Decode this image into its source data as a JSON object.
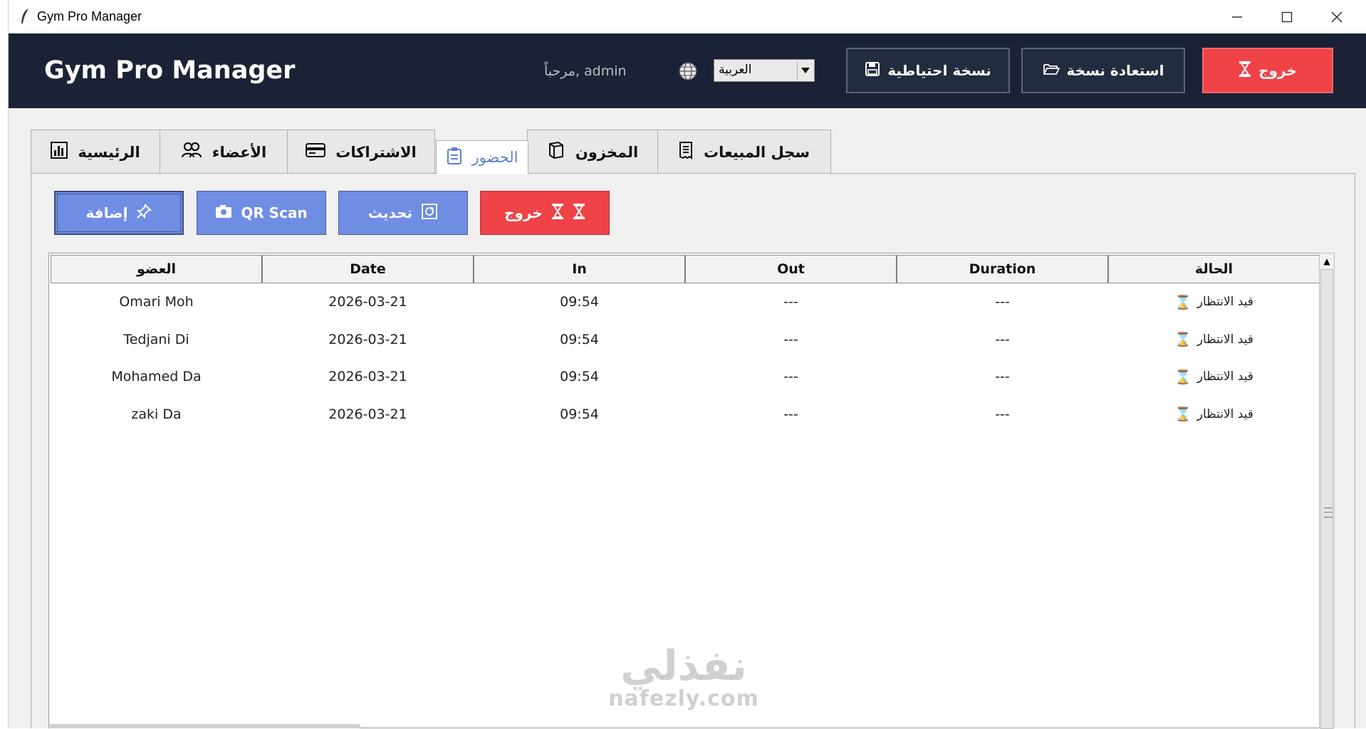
{
  "window": {
    "title": "Gym Pro Manager",
    "controls": {
      "minimize": "—",
      "maximize": "☐",
      "close": "✕"
    }
  },
  "header": {
    "brand": "Gym Pro Manager",
    "welcome": "مرحباً, admin",
    "language": "العربية",
    "backup_label": "نسخة احتياطية",
    "restore_label": "استعادة نسخة",
    "logout_label": "خروج",
    "colors": {
      "background": "#1b2235",
      "logout": "#ef4348"
    }
  },
  "tabs": [
    {
      "label": "سجل المبيعات",
      "icon": "receipt-icon"
    },
    {
      "label": "المخزون",
      "icon": "box-icon"
    },
    {
      "label": "الحضور",
      "icon": "clipboard-icon",
      "active": true
    },
    {
      "label": "الاشتراكات",
      "icon": "card-icon"
    },
    {
      "label": "الأعضاء",
      "icon": "users-icon"
    },
    {
      "label": "الرئيسية",
      "icon": "chart-icon"
    }
  ],
  "actions": {
    "add_label": "إضافة",
    "qr_label": "QR Scan",
    "refresh_label": "تحديث",
    "checkout_label": "خروج",
    "colors": {
      "primary": "#6f8de3",
      "danger": "#ef4348"
    }
  },
  "table": {
    "columns": [
      "العضو",
      "Date",
      "In",
      "Out",
      "Duration",
      "الحالة"
    ],
    "rows": [
      {
        "member": "Omari Moh",
        "date": "2026-03-21",
        "in": "09:54",
        "out": "---",
        "duration": "---",
        "status": "قيد الانتظار"
      },
      {
        "member": "Tedjani Di",
        "date": "2026-03-21",
        "in": "09:54",
        "out": "---",
        "duration": "---",
        "status": "قيد الانتظار"
      },
      {
        "member": "Mohamed Da",
        "date": "2026-03-21",
        "in": "09:54",
        "out": "---",
        "duration": "---",
        "status": "قيد الانتظار"
      },
      {
        "member": "zaki Da",
        "date": "2026-03-21",
        "in": "09:54",
        "out": "---",
        "duration": "---",
        "status": "قيد الانتظار"
      }
    ]
  },
  "watermark": {
    "arabic": "نفذلي",
    "latin": "nafezly.com"
  }
}
